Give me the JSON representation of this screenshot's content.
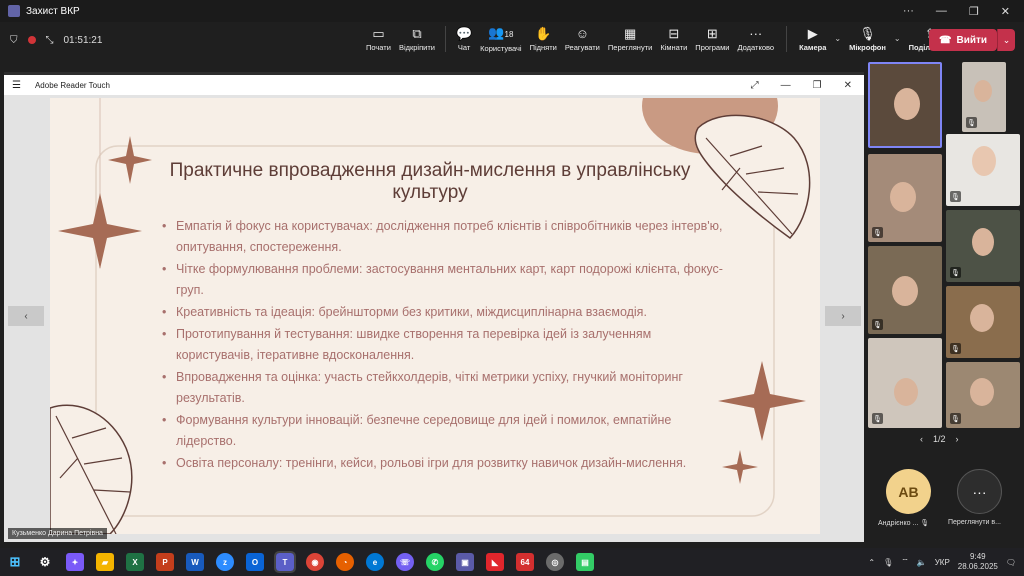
{
  "window": {
    "title": "Захист ВКР"
  },
  "toolbar": {
    "timer": "01:51:21",
    "buttons": [
      {
        "label": "Почати",
        "icon": "screen-icon"
      },
      {
        "label": "Відкріпити",
        "icon": "unpin-icon"
      },
      {
        "label": "Чат",
        "icon": "chat-icon"
      },
      {
        "label": "Користувачі",
        "icon": "people-icon",
        "count": "18"
      },
      {
        "label": "Підняти",
        "icon": "hand-icon"
      },
      {
        "label": "Реагувати",
        "icon": "smile-icon"
      },
      {
        "label": "Переглянути",
        "icon": "grid-icon"
      },
      {
        "label": "Кімнати",
        "icon": "rooms-icon"
      },
      {
        "label": "Програми",
        "icon": "plus-icon"
      },
      {
        "label": "Додатково",
        "icon": "more-icon"
      },
      {
        "label": "Камера",
        "icon": "camera-icon"
      },
      {
        "label": "Мікрофон",
        "icon": "mic-icon"
      },
      {
        "label": "Поділитися",
        "icon": "share-icon"
      }
    ],
    "leave_label": "Вийти"
  },
  "reader": {
    "title": "Adobe Reader Touch"
  },
  "slide": {
    "title": "Практичне впровадження дизайн-мислення в управлінську культуру",
    "bullets": [
      "Емпатія й фокус на користувачах: дослідження потреб клієнтів і співробітників через інтерв'ю, опитування, спостереження.",
      " Чітке формулювання проблеми: застосування ментальних карт, карт подорожі клієнта, фокус-груп.",
      "Креативність та ідеація: брейншторми без критики, міждисциплінарна взаємодія.",
      "Прототипування й тестування: швидке створення та перевірка ідей із залученням користувачів, ітеративне вдосконалення.",
      "Впровадження та оцінка: участь стейкхолдерів, чіткі метрики успіху, гнучкий моніторинг результатів.",
      "Формування культури інновацій: безпечне середовище для ідей і помилок, емпатійне лідерство.",
      "Освіта персоналу: тренінги, кейси, рольові ігри для розвитку навичок дизайн-мислення."
    ]
  },
  "presenter_name": "Кузьменко Дарина Петрівна",
  "pager": {
    "text": "1/2"
  },
  "avatar": {
    "initials": "AB",
    "name": "Андрієнко ...",
    "more_label": "Переглянути в..."
  },
  "colors": {
    "accent": "#c4314b",
    "slide_bg": "#f7efe7",
    "title": "#5e3d37",
    "bullet": "#a8706d",
    "ornament": "#a66b55"
  },
  "taskbar": {
    "lang": "УКР",
    "time": "9:49",
    "date": "28.06.2025",
    "pinned_badge": "64"
  }
}
